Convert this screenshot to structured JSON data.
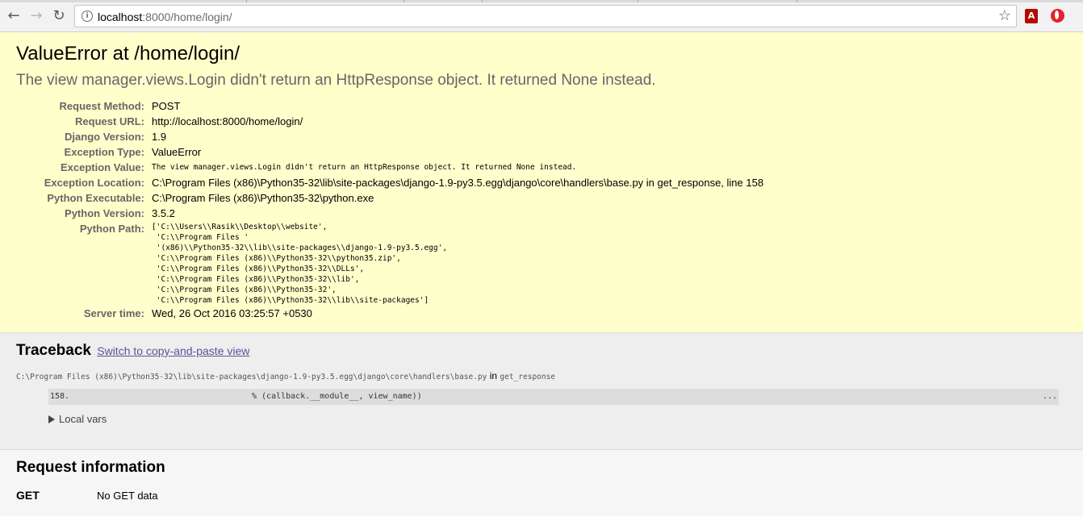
{
  "browser": {
    "url_host": "localhost",
    "url_path": ":8000/home/login/",
    "pdf_ext_glyph": "A",
    "icons": [
      "back-arrow-icon",
      "forward-arrow-icon",
      "reload-icon",
      "info-icon",
      "star-icon",
      "adobe-pdf-icon",
      "opera-icon"
    ],
    "back_glyph": "←",
    "forward_glyph": "→",
    "reload_glyph": "↻",
    "info_glyph": "i",
    "star_glyph": "☆"
  },
  "summary": {
    "title": "ValueError at /home/login/",
    "subtitle": "The view manager.views.Login didn't return an HttpResponse object. It returned None instead.",
    "meta": {
      "request_method_label": "Request Method:",
      "request_method": "POST",
      "request_url_label": "Request URL:",
      "request_url": "http://localhost:8000/home/login/",
      "django_version_label": "Django Version:",
      "django_version": "1.9",
      "exception_type_label": "Exception Type:",
      "exception_type": "ValueError",
      "exception_value_label": "Exception Value:",
      "exception_value": "The view manager.views.Login didn't return an HttpResponse object. It returned None instead.",
      "exception_location_label": "Exception Location:",
      "exception_location": "C:\\Program Files (x86)\\Python35-32\\lib\\site-packages\\django-1.9-py3.5.egg\\django\\core\\handlers\\base.py in get_response, line 158",
      "python_executable_label": "Python Executable:",
      "python_executable": "C:\\Program Files (x86)\\Python35-32\\python.exe",
      "python_version_label": "Python Version:",
      "python_version": "3.5.2",
      "python_path_label": "Python Path:",
      "python_path": "['C:\\\\Users\\\\Rasik\\\\Desktop\\\\website',\n 'C:\\\\Program Files '\n '(x86)\\\\Python35-32\\\\lib\\\\site-packages\\\\django-1.9-py3.5.egg',\n 'C:\\\\Program Files (x86)\\\\Python35-32\\\\python35.zip',\n 'C:\\\\Program Files (x86)\\\\Python35-32\\\\DLLs',\n 'C:\\\\Program Files (x86)\\\\Python35-32\\\\lib',\n 'C:\\\\Program Files (x86)\\\\Python35-32',\n 'C:\\\\Program Files (x86)\\\\Python35-32\\\\lib\\\\site-packages']",
      "server_time_label": "Server time:",
      "server_time": "Wed, 26 Oct 2016 03:25:57 +0530"
    }
  },
  "traceback": {
    "title": "Traceback",
    "switch_link": "Switch to copy-and-paste view",
    "frame_file": "C:\\Program Files (x86)\\Python35-32\\lib\\site-packages\\django-1.9-py3.5.egg\\django\\core\\handlers\\base.py",
    "frame_in": "in",
    "frame_function": "get_response",
    "line_number": "158.",
    "line_code": "% (callback.__module__, view_name))",
    "ellipsis": "...",
    "local_vars": "Local vars"
  },
  "request_info": {
    "title": "Request information",
    "get_label": "GET",
    "get_value": "No GET data"
  }
}
